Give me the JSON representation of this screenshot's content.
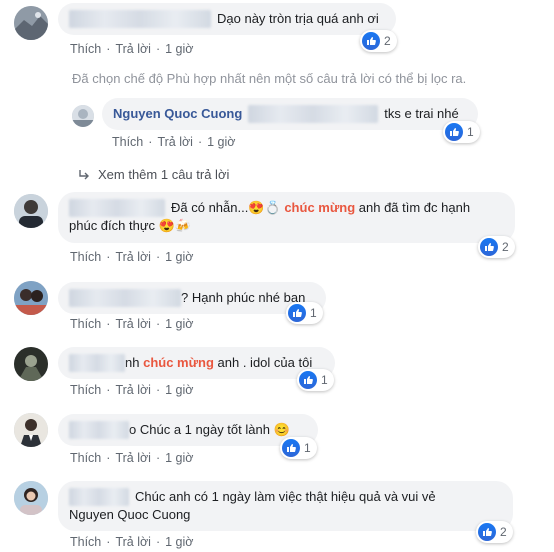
{
  "actions": {
    "like": "Thích",
    "reply": "Trả lời",
    "dot": "·",
    "time": "1 giờ"
  },
  "filter_note": "Đã chọn chế độ Phù hợp nhất nên một số câu trả lời có thể bị lọc ra.",
  "reply": {
    "name": "Nguyen Quoc Cuong",
    "text": "tks e trai nhé",
    "likes": "1"
  },
  "more_replies": "Xem thêm 1 câu trả lời",
  "comments": [
    {
      "text": "Dạo này tròn trịa quá anh ơi",
      "likes": "2"
    },
    {
      "text_before": "Đã có nhẫn...",
      "highlight": "chúc mừng",
      "text_after": "anh đã tìm đc hạnh",
      "line2": "phúc đích thực",
      "likes": "2"
    },
    {
      "text": "Hạnh phúc nhé bạn",
      "prefix": "?",
      "likes": "1"
    },
    {
      "highlight": "chúc mừng",
      "text": "anh . idol của tôi",
      "prefix": "nh",
      "likes": "1"
    },
    {
      "text": "Chúc a 1 ngày tốt lành",
      "prefix": "o",
      "likes": "1"
    },
    {
      "text": "Chúc anh có 1 ngày làm việc thật hiệu quả và vui vẻ",
      "line2": "Nguyen Quoc Cuong",
      "likes": "2"
    }
  ],
  "emoji": {
    "heart_eyes": "😍",
    "ring": "💍",
    "beer": "🍻",
    "smile": "😊"
  },
  "colors": {
    "accent": "#385898",
    "like": "#1877f2",
    "highlight": "#e9573f"
  }
}
